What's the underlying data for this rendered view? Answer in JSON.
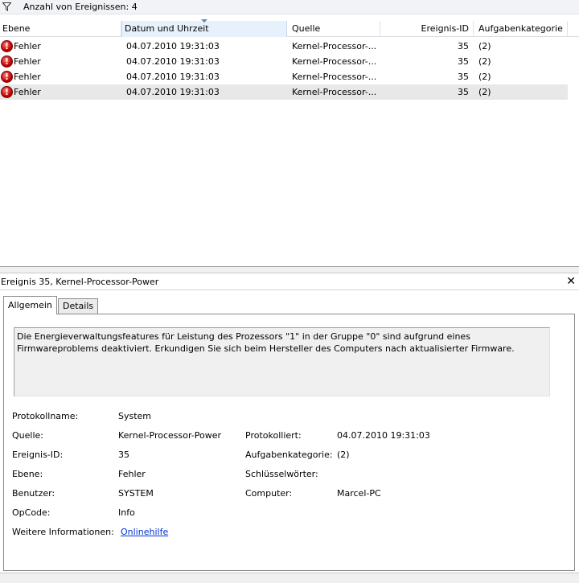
{
  "filter": {
    "count_label": "Anzahl von Ereignissen: 4"
  },
  "columns": [
    "Ebene",
    "Datum und Uhrzeit",
    "Quelle",
    "Ereignis-ID",
    "Aufgabenkategorie"
  ],
  "events": [
    {
      "level": "Fehler",
      "datetime": "04.07.2010 19:31:03",
      "source": "Kernel-Processor-...",
      "id": "35",
      "category": "(2)"
    },
    {
      "level": "Fehler",
      "datetime": "04.07.2010 19:31:03",
      "source": "Kernel-Processor-...",
      "id": "35",
      "category": "(2)"
    },
    {
      "level": "Fehler",
      "datetime": "04.07.2010 19:31:03",
      "source": "Kernel-Processor-...",
      "id": "35",
      "category": "(2)"
    },
    {
      "level": "Fehler",
      "datetime": "04.07.2010 19:31:03",
      "source": "Kernel-Processor-...",
      "id": "35",
      "category": "(2)"
    }
  ],
  "error_icon_glyph": "!",
  "detail": {
    "title": "Ereignis 35, Kernel-Processor-Power",
    "close_glyph": "✕",
    "tabs": [
      "Allgemein",
      "Details"
    ],
    "message": "Die Energieverwaltungsfeatures für Leistung des Prozessors \"1\" in der Gruppe \"0\" sind aufgrund eines Firmwareproblems deaktiviert. Erkundigen Sie sich beim Hersteller des Computers nach aktualisierter Firmware.",
    "labels": {
      "protokollname": "Protokollname:",
      "quelle": "Quelle:",
      "ereignis_id": "Ereignis-ID:",
      "ebene": "Ebene:",
      "benutzer": "Benutzer:",
      "opcode": "OpCode:",
      "weitere": "Weitere Informationen:",
      "protokolliert": "Protokolliert:",
      "aufgabenkategorie": "Aufgabenkategorie:",
      "schluesselwoerter": "Schlüsselwörter:",
      "computer": "Computer:"
    },
    "values": {
      "protokollname": "System",
      "quelle": "Kernel-Processor-Power",
      "ereignis_id": "35",
      "ebene": "Fehler",
      "benutzer": "SYSTEM",
      "opcode": "Info",
      "weitere": "Onlinehilfe",
      "protokolliert": "04.07.2010 19:31:03",
      "aufgabenkategorie": "(2)",
      "schluesselwoerter": "",
      "computer": "Marcel-PC"
    }
  },
  "colors": {
    "sorted_column_bg": "#e7f1fb",
    "selected_row_bg": "#e8e8e8",
    "link": "#0033cc",
    "error_red": "#c40000"
  },
  "icons": {
    "filter": "filter-funnel-icon",
    "error": "error-icon",
    "close": "close-icon",
    "sort": "sort-descending-icon"
  }
}
